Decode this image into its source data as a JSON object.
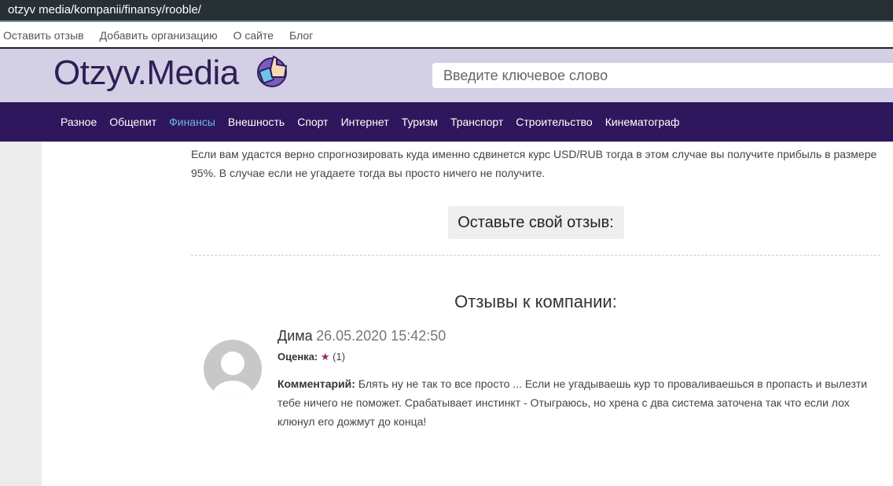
{
  "browser": {
    "url": "otzyv media/kompanii/finansy/rooble/"
  },
  "toplinks": [
    "Оставить отзыв",
    "Добавить организацию",
    "О сайте",
    "Блог"
  ],
  "header": {
    "logo": "Otzyv.Media",
    "search_placeholder": "Введите ключевое слово"
  },
  "nav": [
    "Разное",
    "Общепит",
    "Финансы",
    "Внешность",
    "Спорт",
    "Интернет",
    "Туризм",
    "Транспорт",
    "Строительство",
    "Кинематограф"
  ],
  "nav_active": "Финансы",
  "content": {
    "intro": "Если вам удастся верно спрогнозировать куда именно сдвинется курс USD/RUB тогда в этом случае вы получите прибыль в размере 95%. В случае если не угадаете тогда вы просто ничего не получите.",
    "leave_review": "Оставьте свой отзыв:",
    "reviews_title": "Отзывы к компании:",
    "review": {
      "name": "Дима",
      "date": "26.05.2020 15:42:50",
      "rating_label": "Оценка:",
      "rating_count": "(1)",
      "rating_value": 1,
      "comment_label": "Комментарий:",
      "comment": "Блять ну не так то все просто ... Если не угадываешь кур то проваливаешься в пропасть и вылезти тебе ничего не поможет. Срабатывает инстинкт - Отыграюсь, но хрена с два система заточена так что если лох клюнул его дожмут до конца!"
    }
  },
  "colors": {
    "nav_bg": "#2e175c",
    "header_bg": "#d3cfe5",
    "active": "#6bb7e8",
    "star": "#8b2c6e"
  }
}
